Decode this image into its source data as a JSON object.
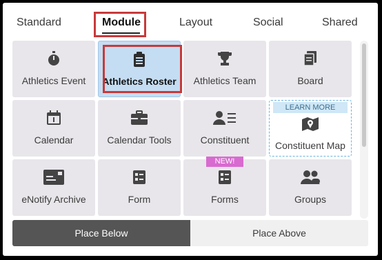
{
  "tabs": [
    {
      "label": "Standard"
    },
    {
      "label": "Module"
    },
    {
      "label": "Layout"
    },
    {
      "label": "Social"
    },
    {
      "label": "Shared"
    }
  ],
  "active_tab": "Module",
  "tiles": [
    {
      "label": "Athletics Event",
      "icon": "stopwatch-icon"
    },
    {
      "label": "Athletics Roster",
      "icon": "clipboard-icon",
      "selected": true
    },
    {
      "label": "Athletics Team",
      "icon": "trophy-icon"
    },
    {
      "label": "Board",
      "icon": "stacked-pages-icon"
    },
    {
      "label": "Calendar",
      "icon": "calendar-icon"
    },
    {
      "label": "Calendar Tools",
      "icon": "toolbox-icon"
    },
    {
      "label": "Constituent",
      "icon": "person-list-icon"
    },
    {
      "label": "Constituent Map",
      "icon": "map-pin-icon",
      "badge": "LEARN MORE"
    },
    {
      "label": "eNotify Archive",
      "icon": "mail-card-icon"
    },
    {
      "label": "Form",
      "icon": "form-icon"
    },
    {
      "label": "Forms",
      "icon": "forms-icon",
      "badge": "NEW!"
    },
    {
      "label": "Groups",
      "icon": "people-icon"
    }
  ],
  "buttons": {
    "place_below": "Place Below",
    "place_above": "Place Above"
  },
  "colors": {
    "highlight_box": "#c8393a",
    "selected_tile": "#c4ddf2",
    "new_badge": "#d86ad0",
    "learn_badge": "#cfe7f6"
  }
}
